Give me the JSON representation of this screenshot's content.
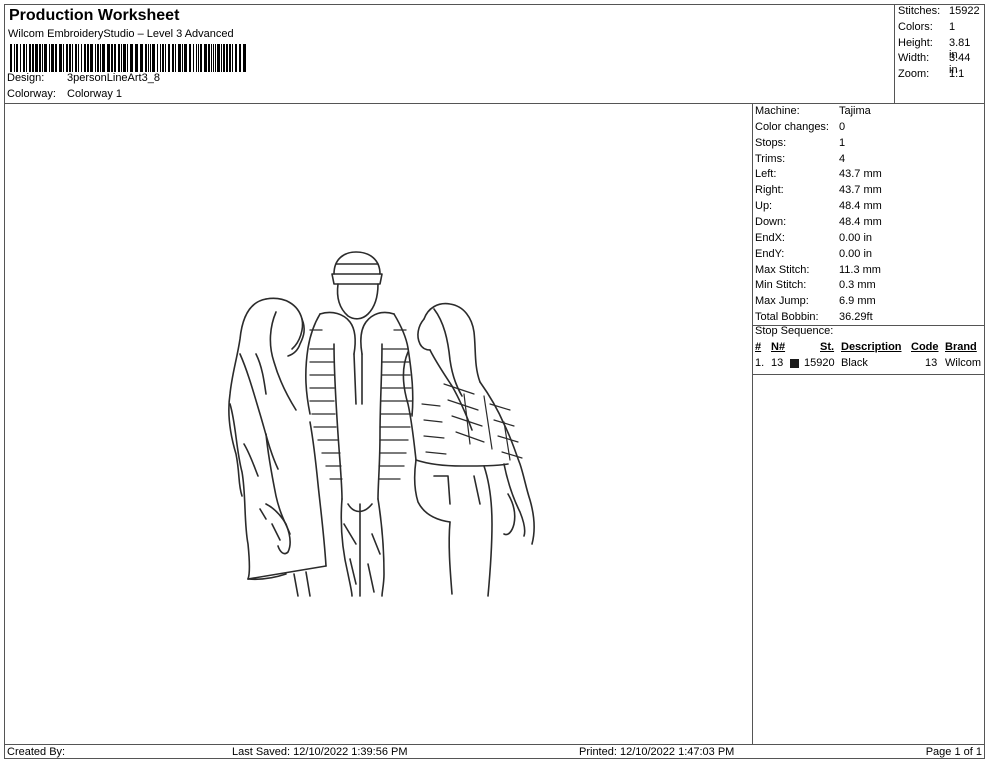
{
  "header": {
    "title": "Production Worksheet",
    "software": "Wilcom EmbroideryStudio – Level 3 Advanced",
    "design_label": "Design:",
    "design_value": "3personLineArt3_8",
    "colorway_label": "Colorway:",
    "colorway_value": "Colorway 1"
  },
  "summary": {
    "stitches_label": "Stitches:",
    "stitches_value": "15922",
    "colors_label": "Colors:",
    "colors_value": "1",
    "height_label": "Height:",
    "height_value": "3.81 in",
    "width_label": "Width:",
    "width_value": "3.44 in",
    "zoom_label": "Zoom:",
    "zoom_value": "1:1"
  },
  "machine_info": [
    {
      "label": "Machine:",
      "value": "Tajima"
    },
    {
      "label": "Color changes:",
      "value": "0"
    },
    {
      "label": "Stops:",
      "value": "1"
    },
    {
      "label": "Trims:",
      "value": "4"
    },
    {
      "label": "Left:",
      "value": "43.7 mm"
    },
    {
      "label": "Right:",
      "value": "43.7 mm"
    },
    {
      "label": "Up:",
      "value": "48.4 mm"
    },
    {
      "label": "Down:",
      "value": "48.4 mm"
    },
    {
      "label": "EndX:",
      "value": "0.00 in"
    },
    {
      "label": "EndY:",
      "value": "0.00 in"
    },
    {
      "label": "Max Stitch:",
      "value": "11.3 mm"
    },
    {
      "label": "Min Stitch:",
      "value": "0.3 mm"
    },
    {
      "label": "Max Jump:",
      "value": "6.9 mm"
    },
    {
      "label": "Total Bobbin:",
      "value": "36.29ft"
    }
  ],
  "stop_sequence": {
    "title": "Stop Sequence:",
    "columns": [
      "#",
      "N#",
      "St.",
      "Description",
      "Code",
      "Brand"
    ],
    "rows": [
      {
        "num": "1.",
        "n": "13",
        "color": "#1a1a1a",
        "stitches": "15920",
        "description": "Black",
        "code": "13",
        "brand": "Wilcom"
      }
    ]
  },
  "footer": {
    "created_by": "Created By:",
    "last_saved": "Last Saved: 12/10/2022 1:39:56 PM",
    "printed": "Printed: 12/10/2022 1:47:03 PM",
    "page": "Page 1 of 1"
  }
}
